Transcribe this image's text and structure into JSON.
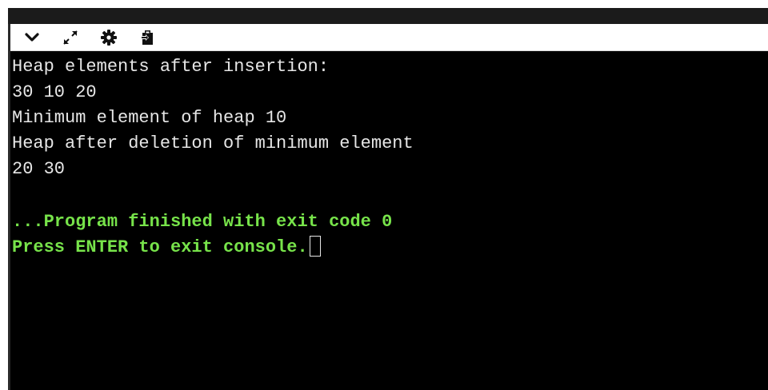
{
  "toolbar": {
    "buttons": [
      {
        "icon": "chevron-down-icon"
      },
      {
        "icon": "expand-icon"
      },
      {
        "icon": "gear-icon"
      },
      {
        "icon": "clipboard-icon"
      }
    ]
  },
  "console": {
    "output_lines": [
      "Heap elements after insertion:",
      "30 10 20",
      "Minimum element of heap 10",
      "Heap after deletion of minimum element",
      "20 30"
    ],
    "status_lines": [
      "...Program finished with exit code 0",
      "Press ENTER to exit console."
    ]
  },
  "colors": {
    "console_bg": "#000000",
    "output_text": "#e6e6e6",
    "status_text": "#77e34a",
    "toolbar_bg": "#ffffff"
  }
}
